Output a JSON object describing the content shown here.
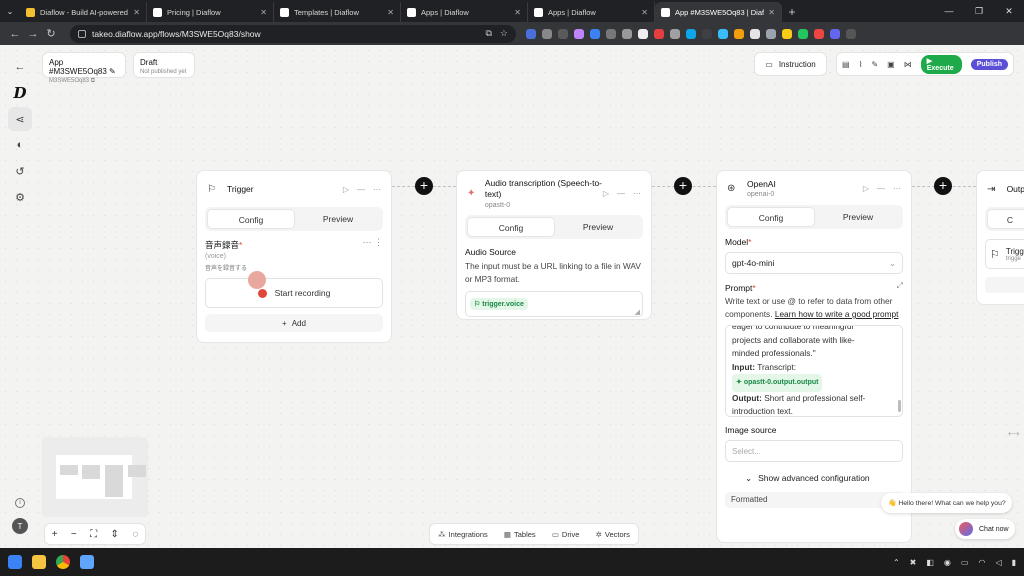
{
  "browser": {
    "tabs": [
      {
        "title": "Diaflow - Build AI-powered app",
        "active": false
      },
      {
        "title": "Pricing | Diaflow",
        "active": false
      },
      {
        "title": "Templates | Diaflow",
        "active": false
      },
      {
        "title": "Apps | Diaflow",
        "active": false
      },
      {
        "title": "Apps | Diaflow",
        "active": false
      },
      {
        "title": "App #M3SWE5Oq83 | Diaflow",
        "active": true
      }
    ],
    "url": "takeo.diaflow.app/flows/M3SWE5Oq83/show"
  },
  "app_header": {
    "app_name": "App #M3SWE5Oq83",
    "app_id": "M3SWE5Oq83",
    "status": "Draft",
    "status_sub": "Not published yet",
    "instruction_label": "Instruction",
    "execute_label": "Execute",
    "publish_label": "Publish"
  },
  "colors": {
    "execute": "#1faa4a",
    "publish": "#5b4fd8",
    "chip_bg": "#e3f6e8",
    "chip_text": "#1a8a45"
  },
  "trigger": {
    "title": "Trigger",
    "tab_config": "Config",
    "tab_preview": "Preview",
    "field_label": "音声録音",
    "field_type": "(voice)",
    "field_desc": "音声を録音する",
    "record_label": "Start recording",
    "add_label": "Add"
  },
  "audio": {
    "title": "Audio transcription (Speech-to-text)",
    "id": "opastt-0",
    "tab_config": "Config",
    "tab_preview": "Preview",
    "source_label": "Audio Source",
    "source_desc": "The input must be a URL linking to a file in WAV or MP3 format.",
    "chip": "trigger.voice"
  },
  "openai": {
    "title": "OpenAI",
    "id": "openai-0",
    "tab_config": "Config",
    "tab_preview": "Preview",
    "model_label": "Model",
    "model_value": "gpt-4o-mini",
    "prompt_label": "Prompt",
    "prompt_desc": "Write text or use @ to refer to data from other components.",
    "prompt_link": "Learn how to write a good prompt",
    "prompt_line1": "eager to contribute to meaningful",
    "prompt_line2": "projects and collaborate with like-",
    "prompt_line3": "minded professionals.\"",
    "input_label": "Input:",
    "input_text": "Transcript:",
    "input_chip": "opastt-0.output.output",
    "output_label": "Output:",
    "output_text": "Short and professional self-introduction text.",
    "image_label": "Image source",
    "image_placeholder": "Select...",
    "advanced_label": "Show advanced configuration",
    "formatted_label": "Formatted"
  },
  "output_node": {
    "title": "Outp",
    "tab": "C",
    "item": "Trigg",
    "item_sub": "trigge"
  },
  "bottom": {
    "integrations": "Integrations",
    "tables": "Tables",
    "drive": "Drive",
    "vectors": "Vectors",
    "chat_bubble": "👋 Hello there! What can we help you?",
    "chat_now": "Chat now"
  },
  "user_initial": "T"
}
